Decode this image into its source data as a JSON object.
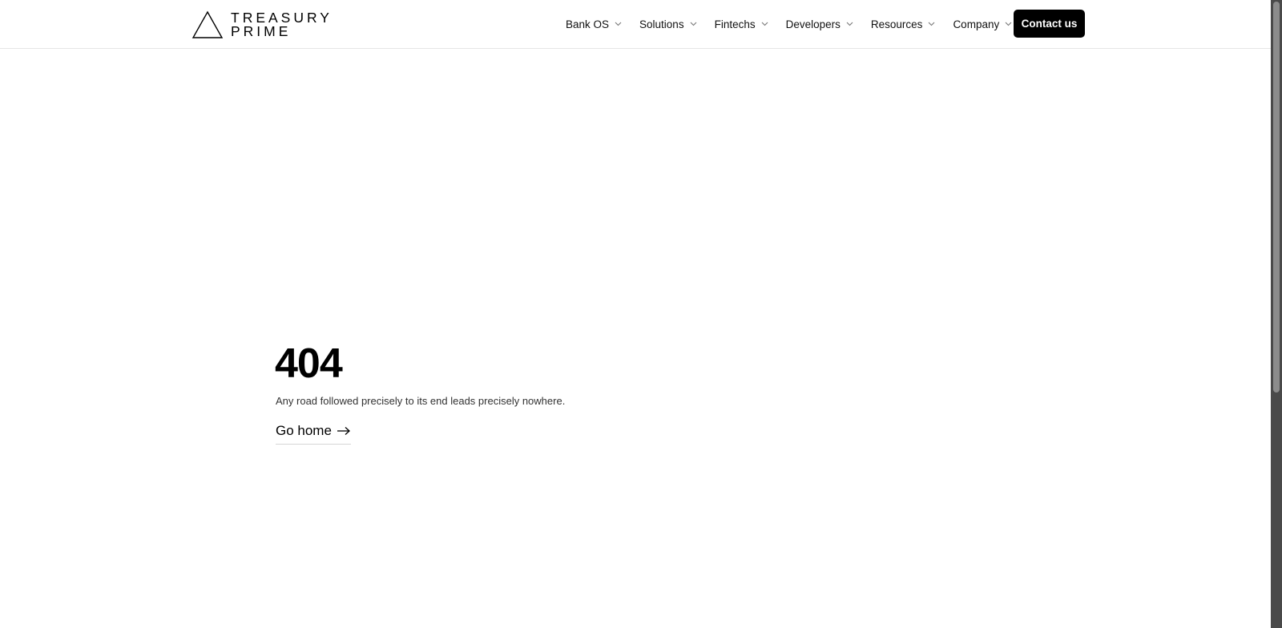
{
  "brand": {
    "line1": "TREASURY",
    "line2": "PRIME"
  },
  "nav": {
    "items": [
      {
        "label": "Bank OS"
      },
      {
        "label": "Solutions"
      },
      {
        "label": "Fintechs"
      },
      {
        "label": "Developers"
      },
      {
        "label": "Resources"
      },
      {
        "label": "Company"
      }
    ],
    "cta_label": "Contact us"
  },
  "error": {
    "code": "404",
    "message": "Any road followed precisely to its end leads precisely nowhere.",
    "home_link": "Go home"
  },
  "icons": {
    "logo": "triangle-logo-icon",
    "chevron": "chevron-down-icon",
    "arrow": "arrow-right-icon"
  }
}
